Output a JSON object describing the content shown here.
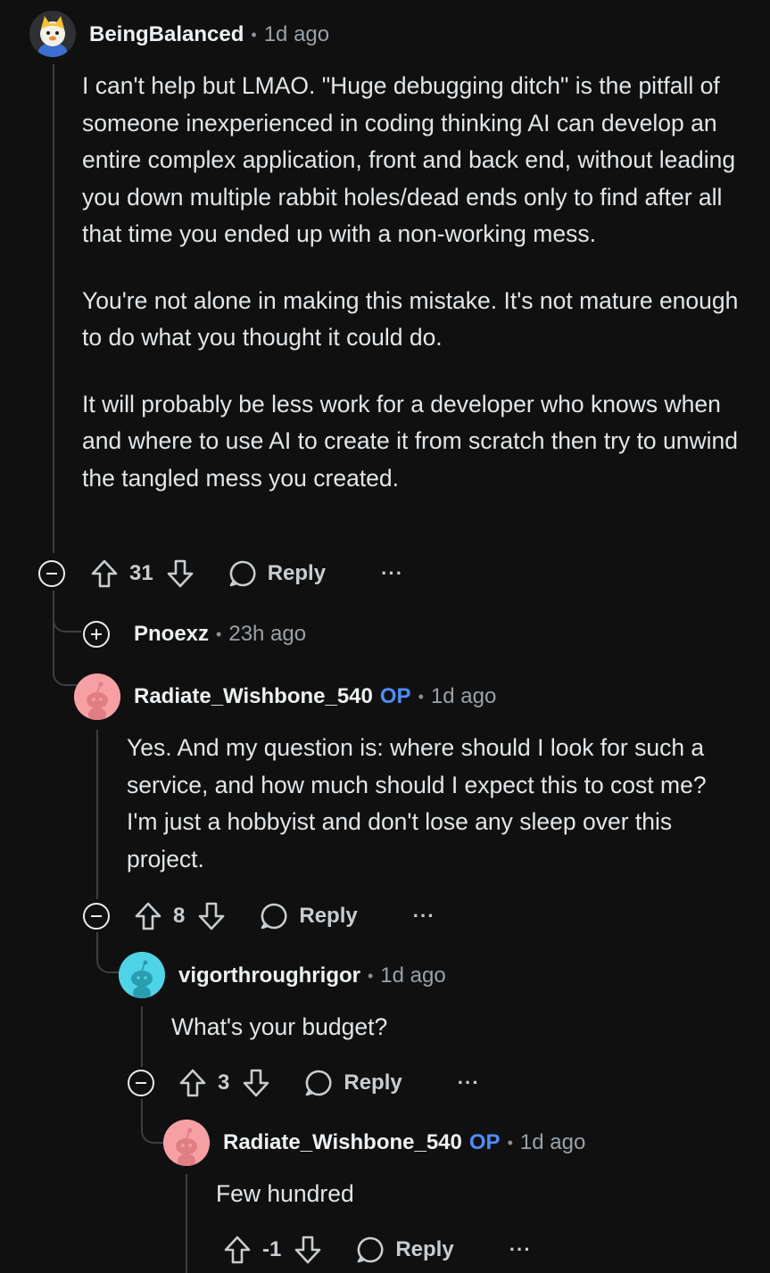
{
  "comments": [
    {
      "author": "BeingBalanced",
      "age": "1d ago",
      "paragraphs": [
        "I can't help but LMAO. \"Huge debugging ditch\" is the pitfall of someone inexperienced in coding thinking AI can develop an entire complex application, front and back end, without leading you down multiple rabbit holes/dead ends only to find after all that time you ended up with a non-working mess.",
        "You're not alone in making this mistake. It's not mature enough to do what you thought it could do.",
        "It will probably be less work for a developer who knows when and where to use AI to create it from scratch then try to unwind the tangled mess you created."
      ],
      "votes": "31",
      "reply_label": "Reply",
      "more_label": "···"
    },
    {
      "author": "Pnoexz",
      "age": "23h ago",
      "collapsed": true
    },
    {
      "author": "Radiate_Wishbone_540",
      "op_label": "OP",
      "age": "1d ago",
      "paragraphs": [
        "Yes. And my question is: where should I look for such a service, and how much should I expect this to cost me? I'm just a hobbyist and don't lose any sleep over this project."
      ],
      "votes": "8",
      "reply_label": "Reply",
      "more_label": "···"
    },
    {
      "author": "vigorthroughrigor",
      "age": "1d ago",
      "paragraphs": [
        "What's your budget?"
      ],
      "votes": "3",
      "reply_label": "Reply",
      "more_label": "···"
    },
    {
      "author": "Radiate_Wishbone_540",
      "op_label": "OP",
      "age": "1d ago",
      "paragraphs": [
        "Few hundred"
      ],
      "votes": "-1",
      "reply_label": "Reply",
      "more_label": "···"
    }
  ],
  "separator": "•",
  "colors": {
    "background": "#101010",
    "op_accent": "#4f8df6",
    "avatar_pink": "#f6a0a4",
    "avatar_cyan": "#4fd3e6",
    "thread_line": "#3b3f44"
  },
  "icons": [
    "collapse-icon",
    "expand-icon",
    "upvote-icon",
    "downvote-icon",
    "reply-bubble-icon",
    "more-options-icon",
    "snoo-avatar-icon"
  ]
}
